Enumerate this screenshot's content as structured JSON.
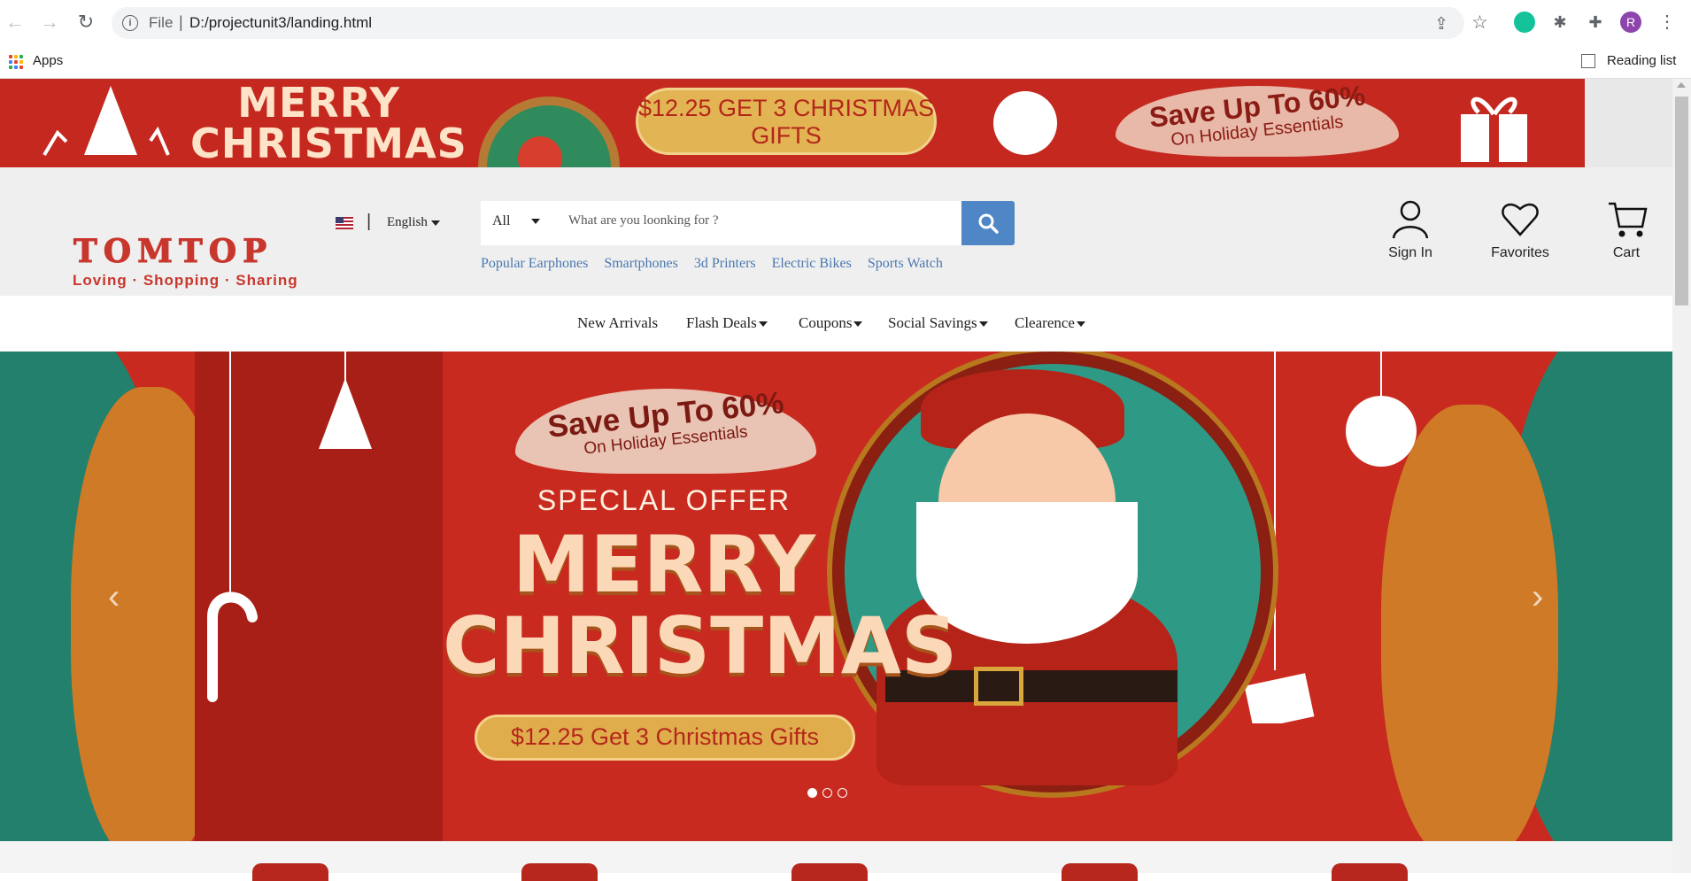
{
  "browser": {
    "protocol_label": "File",
    "url": "D:/projectunit3/landing.html",
    "bookmarks_apps": "Apps",
    "reading_list": "Reading list",
    "profile_initial": "R"
  },
  "top_banner": {
    "headline": "MERRY CHRISTMAS",
    "offer": "$12.25 GET 3 CHRISTMAS GIFTS",
    "save_title": "Save Up To 60%",
    "save_sub": "On Holiday Essentials"
  },
  "header": {
    "logo_title": "TOMTOP",
    "logo_tagline": "Loving · Shopping · Sharing",
    "language": "English",
    "search": {
      "category": "All",
      "placeholder": "What are you loonking for ?"
    },
    "quick_links": [
      "Popular Earphones",
      "Smartphones",
      "3d Printers",
      "Electric Bikes",
      "Sports Watch"
    ],
    "actions": {
      "sign_in": "Sign In",
      "favorites": "Favorites",
      "cart": "Cart"
    }
  },
  "nav": {
    "items": [
      "New Arrivals",
      "Flash Deals",
      "Coupons",
      "Social Savings",
      "Clearence"
    ]
  },
  "hero": {
    "save_title": "Save Up To 60%",
    "save_sub": "On Holiday Essentials",
    "special": "SPECLAL OFFER",
    "headline_1": "MERRY",
    "headline_2": "CHRISTMAS",
    "offer": "$12.25 Get 3 Christmas Gifts",
    "slides_total": 3,
    "slide_active": 1
  },
  "colors": {
    "brand_red": "#c8372d",
    "search_blue": "#4f86c6",
    "link_blue": "#4a78ae",
    "banner_red": "#c4281f",
    "hero_green": "#23806c"
  }
}
